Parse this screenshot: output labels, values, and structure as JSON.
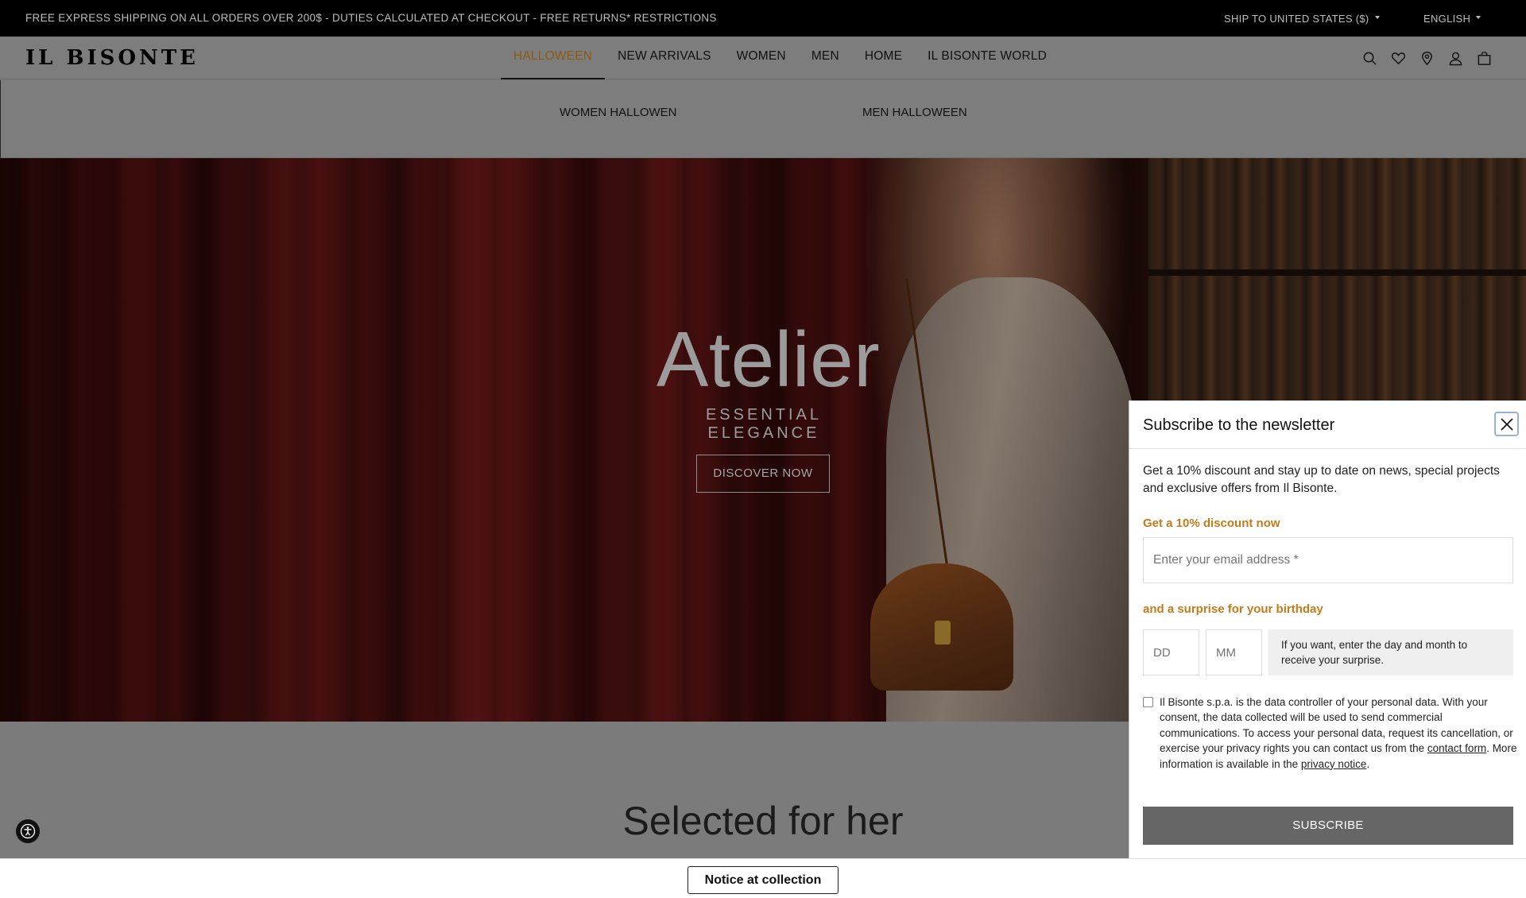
{
  "topbar": {
    "promo": "FREE EXPRESS SHIPPING ON ALL ORDERS OVER 200$ - DUTIES CALCULATED AT CHECKOUT - FREE RETURNS* RESTRICTIONS",
    "ship_to": "SHIP TO UNITED STATES ($)",
    "language": "ENGLISH"
  },
  "header": {
    "logo": "IL BISONTE",
    "nav": [
      "HALLOWEEN",
      "NEW ARRIVALS",
      "WOMEN",
      "MEN",
      "HOME",
      "IL BISONTE WORLD"
    ],
    "active_nav": "HALLOWEEN",
    "icons": [
      "search-icon",
      "heart-icon",
      "location-pin-icon",
      "account-icon",
      "bag-icon"
    ]
  },
  "dropdown": {
    "items": [
      "WOMEN HALLOWEN",
      "MEN HALLOWEEN"
    ]
  },
  "hero": {
    "title": "Atelier",
    "subtitle": "ESSENTIAL ELEGANCE",
    "button": "DISCOVER NOW"
  },
  "section": {
    "title": "Selected for her"
  },
  "notice": {
    "label": "Notice at collection"
  },
  "newsletter": {
    "title": "Subscribe to the newsletter",
    "description": "Get a 10% discount and stay up to date on news, special projects and exclusive offers from Il Bisonte.",
    "discount_label": "Get a 10% discount now",
    "email_placeholder": "Enter your email address *",
    "birthday_label": "and a surprise for your birthday",
    "day_placeholder": "DD",
    "month_placeholder": "MM",
    "birthday_hint": "If you want, enter the day and month to receive your surprise.",
    "consent_part1": "Il Bisonte s.p.a. is the data controller of your personal data. With your consent, the data collected will be used to send commercial communications. To access your personal data, request its cancellation, or exercise your privacy rights you can contact us from the ",
    "consent_link1": "contact form",
    "consent_part2": ". More information is available in the ",
    "consent_link2": "privacy notice",
    "consent_part3": ".",
    "subscribe_label": "SUBSCRIBE"
  },
  "colors": {
    "accent": "#c67a18",
    "active_nav": "#8a5a14",
    "overlay": "#7b7b7b"
  }
}
